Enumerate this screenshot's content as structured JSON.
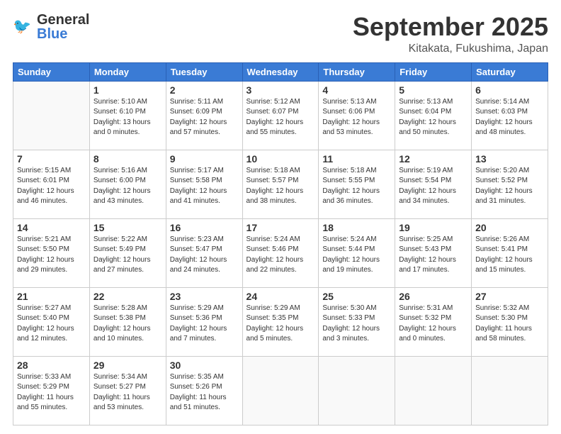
{
  "header": {
    "logo": {
      "general": "General",
      "blue": "Blue"
    },
    "month": "September 2025",
    "location": "Kitakata, Fukushima, Japan"
  },
  "weekdays": [
    "Sunday",
    "Monday",
    "Tuesday",
    "Wednesday",
    "Thursday",
    "Friday",
    "Saturday"
  ],
  "weeks": [
    [
      {
        "day": "",
        "info": ""
      },
      {
        "day": "1",
        "info": "Sunrise: 5:10 AM\nSunset: 6:10 PM\nDaylight: 13 hours\nand 0 minutes."
      },
      {
        "day": "2",
        "info": "Sunrise: 5:11 AM\nSunset: 6:09 PM\nDaylight: 12 hours\nand 57 minutes."
      },
      {
        "day": "3",
        "info": "Sunrise: 5:12 AM\nSunset: 6:07 PM\nDaylight: 12 hours\nand 55 minutes."
      },
      {
        "day": "4",
        "info": "Sunrise: 5:13 AM\nSunset: 6:06 PM\nDaylight: 12 hours\nand 53 minutes."
      },
      {
        "day": "5",
        "info": "Sunrise: 5:13 AM\nSunset: 6:04 PM\nDaylight: 12 hours\nand 50 minutes."
      },
      {
        "day": "6",
        "info": "Sunrise: 5:14 AM\nSunset: 6:03 PM\nDaylight: 12 hours\nand 48 minutes."
      }
    ],
    [
      {
        "day": "7",
        "info": "Sunrise: 5:15 AM\nSunset: 6:01 PM\nDaylight: 12 hours\nand 46 minutes."
      },
      {
        "day": "8",
        "info": "Sunrise: 5:16 AM\nSunset: 6:00 PM\nDaylight: 12 hours\nand 43 minutes."
      },
      {
        "day": "9",
        "info": "Sunrise: 5:17 AM\nSunset: 5:58 PM\nDaylight: 12 hours\nand 41 minutes."
      },
      {
        "day": "10",
        "info": "Sunrise: 5:18 AM\nSunset: 5:57 PM\nDaylight: 12 hours\nand 38 minutes."
      },
      {
        "day": "11",
        "info": "Sunrise: 5:18 AM\nSunset: 5:55 PM\nDaylight: 12 hours\nand 36 minutes."
      },
      {
        "day": "12",
        "info": "Sunrise: 5:19 AM\nSunset: 5:54 PM\nDaylight: 12 hours\nand 34 minutes."
      },
      {
        "day": "13",
        "info": "Sunrise: 5:20 AM\nSunset: 5:52 PM\nDaylight: 12 hours\nand 31 minutes."
      }
    ],
    [
      {
        "day": "14",
        "info": "Sunrise: 5:21 AM\nSunset: 5:50 PM\nDaylight: 12 hours\nand 29 minutes."
      },
      {
        "day": "15",
        "info": "Sunrise: 5:22 AM\nSunset: 5:49 PM\nDaylight: 12 hours\nand 27 minutes."
      },
      {
        "day": "16",
        "info": "Sunrise: 5:23 AM\nSunset: 5:47 PM\nDaylight: 12 hours\nand 24 minutes."
      },
      {
        "day": "17",
        "info": "Sunrise: 5:24 AM\nSunset: 5:46 PM\nDaylight: 12 hours\nand 22 minutes."
      },
      {
        "day": "18",
        "info": "Sunrise: 5:24 AM\nSunset: 5:44 PM\nDaylight: 12 hours\nand 19 minutes."
      },
      {
        "day": "19",
        "info": "Sunrise: 5:25 AM\nSunset: 5:43 PM\nDaylight: 12 hours\nand 17 minutes."
      },
      {
        "day": "20",
        "info": "Sunrise: 5:26 AM\nSunset: 5:41 PM\nDaylight: 12 hours\nand 15 minutes."
      }
    ],
    [
      {
        "day": "21",
        "info": "Sunrise: 5:27 AM\nSunset: 5:40 PM\nDaylight: 12 hours\nand 12 minutes."
      },
      {
        "day": "22",
        "info": "Sunrise: 5:28 AM\nSunset: 5:38 PM\nDaylight: 12 hours\nand 10 minutes."
      },
      {
        "day": "23",
        "info": "Sunrise: 5:29 AM\nSunset: 5:36 PM\nDaylight: 12 hours\nand 7 minutes."
      },
      {
        "day": "24",
        "info": "Sunrise: 5:29 AM\nSunset: 5:35 PM\nDaylight: 12 hours\nand 5 minutes."
      },
      {
        "day": "25",
        "info": "Sunrise: 5:30 AM\nSunset: 5:33 PM\nDaylight: 12 hours\nand 3 minutes."
      },
      {
        "day": "26",
        "info": "Sunrise: 5:31 AM\nSunset: 5:32 PM\nDaylight: 12 hours\nand 0 minutes."
      },
      {
        "day": "27",
        "info": "Sunrise: 5:32 AM\nSunset: 5:30 PM\nDaylight: 11 hours\nand 58 minutes."
      }
    ],
    [
      {
        "day": "28",
        "info": "Sunrise: 5:33 AM\nSunset: 5:29 PM\nDaylight: 11 hours\nand 55 minutes."
      },
      {
        "day": "29",
        "info": "Sunrise: 5:34 AM\nSunset: 5:27 PM\nDaylight: 11 hours\nand 53 minutes."
      },
      {
        "day": "30",
        "info": "Sunrise: 5:35 AM\nSunset: 5:26 PM\nDaylight: 11 hours\nand 51 minutes."
      },
      {
        "day": "",
        "info": ""
      },
      {
        "day": "",
        "info": ""
      },
      {
        "day": "",
        "info": ""
      },
      {
        "day": "",
        "info": ""
      }
    ]
  ]
}
